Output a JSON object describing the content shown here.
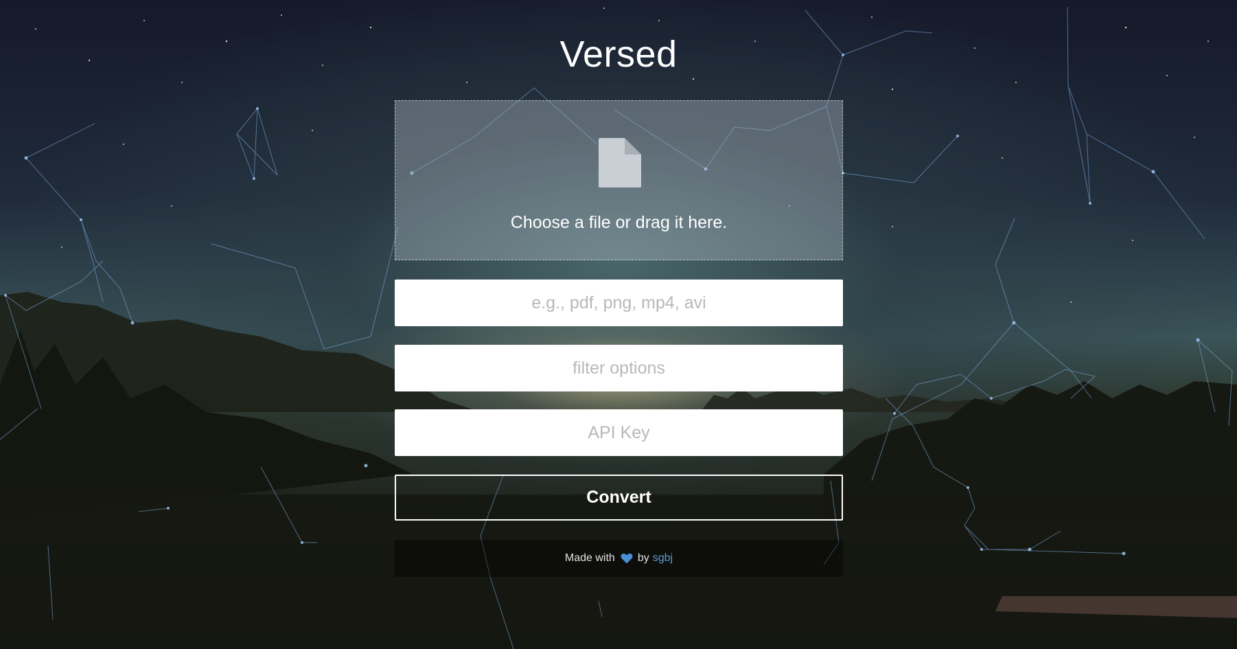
{
  "app": {
    "title": "Versed"
  },
  "dropzone": {
    "label": "Choose a file or drag it here.",
    "icon": "file-icon"
  },
  "fields": {
    "format_placeholder": "e.g., pdf, png, mp4, avi",
    "filter_placeholder": "filter options",
    "api_key_placeholder": "API Key"
  },
  "actions": {
    "convert_label": "Convert"
  },
  "footer": {
    "made_with": "Made with",
    "heart_icon": "heart-icon",
    "by": "by",
    "author": "sgbj"
  },
  "colors": {
    "link": "#5b9bd5",
    "heart": "#4a90d9",
    "network": "#7fb0e8"
  }
}
